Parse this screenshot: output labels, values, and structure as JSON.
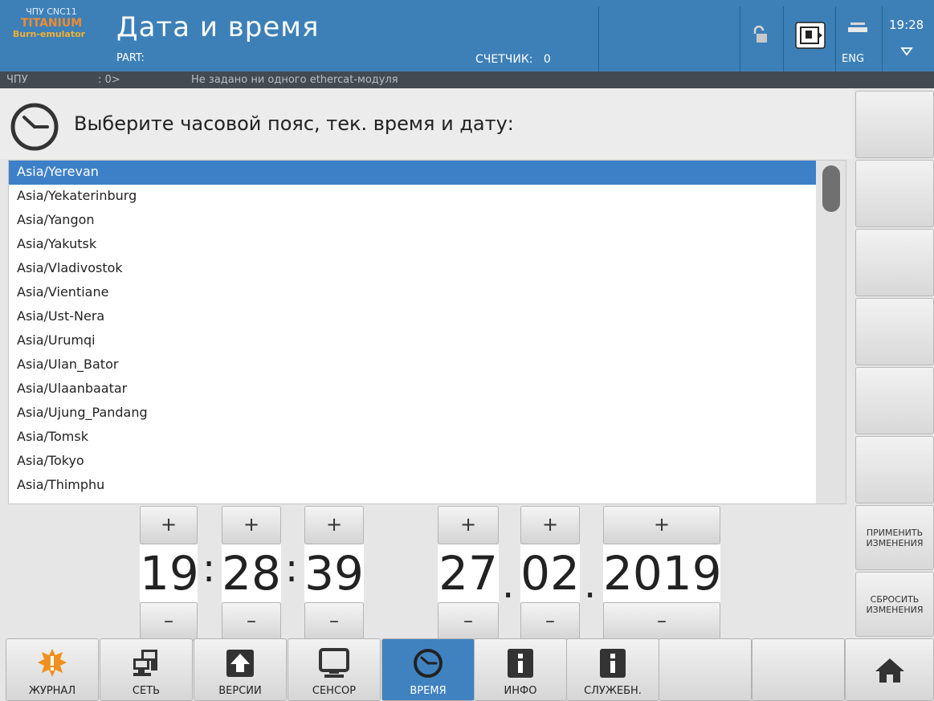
{
  "header": {
    "brand_line1": "ЧПУ CNC11",
    "brand_line2": "TITANIUM",
    "brand_line3": "Burn-emulator",
    "title": "Дата и время",
    "part_label": "PART:",
    "counter_label": "СЧЕТЧИК:",
    "counter_value": "0",
    "language": "ENG",
    "clock": "19:28",
    "icons": [
      "lock-icon",
      "monitor-icon",
      "keyboard-icon",
      "dropdown-triangle-icon"
    ]
  },
  "statusbar": {
    "mode": "ЧПУ",
    "channel": ": 0>",
    "message": "Не задано ни одного ethercat-модуля"
  },
  "heading": {
    "text": "Выберите часовой пояс, тек. время и дату:",
    "icon": "clock-icon"
  },
  "timezones": {
    "selected_index": 0,
    "items": [
      "Asia/Yerevan",
      "Asia/Yekaterinburg",
      "Asia/Yangon",
      "Asia/Yakutsk",
      "Asia/Vladivostok",
      "Asia/Vientiane",
      "Asia/Ust-Nera",
      "Asia/Urumqi",
      "Asia/Ulan_Bator",
      "Asia/Ulaanbaatar",
      "Asia/Ujung_Pandang",
      "Asia/Tomsk",
      "Asia/Tokyo",
      "Asia/Thimphu"
    ]
  },
  "datetime": {
    "plus": "+",
    "minus": "–",
    "time_sep": ":",
    "date_sep": ".",
    "hours": "19",
    "minutes": "28",
    "seconds": "39",
    "day": "27",
    "month": "02",
    "year": "2019"
  },
  "side": {
    "apply_label": "ПРИМЕНИТЬ ИЗМЕНЕНИЯ",
    "reset_label": "СБРОСИТЬ ИЗМЕНЕНИЯ"
  },
  "nav": {
    "journal": "ЖУРНАЛ",
    "network": "СЕТЬ",
    "versions": "ВЕРСИИ",
    "sensor": "СЕНСОР",
    "time": "ВРЕМЯ",
    "info": "ИНФО",
    "service": "СЛУЖЕБН."
  },
  "colors": {
    "header_bg": "#3d80b8",
    "selection": "#3d80c8",
    "brand_orange": "#f08b30",
    "journal_icon": "#f09020"
  }
}
